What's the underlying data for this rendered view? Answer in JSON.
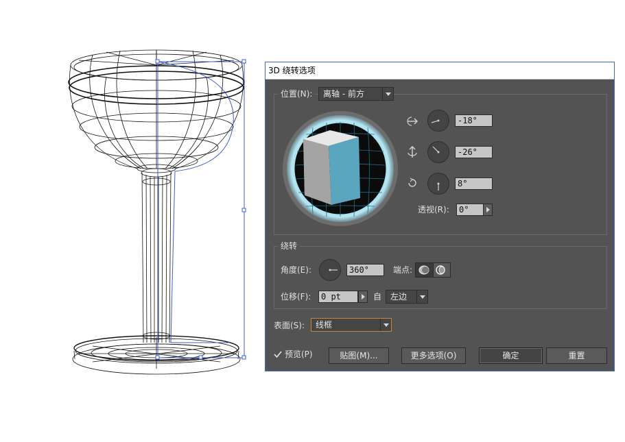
{
  "dialog": {
    "title": "3D 绕转选项",
    "position": {
      "group_label": "位置(N):",
      "preset": "离轴 - 前方",
      "x_rotation": "-18°",
      "y_rotation": "-26°",
      "z_rotation": "8°",
      "perspective_label": "透视(R):",
      "perspective_value": "0°"
    },
    "revolve": {
      "group_label": "绕转",
      "angle_label": "角度(E):",
      "angle_value": "360°",
      "cap_label": "端点:",
      "offset_label": "位移(F):",
      "offset_value": "0 pt",
      "from_label": "自",
      "from_value": "左边"
    },
    "surface": {
      "label": "表面(S):",
      "value": "线框"
    },
    "footer": {
      "preview_label": "预览(P)",
      "preview_checked": true,
      "map_art_label": "贴图(M)...",
      "more_options_label": "更多选项(O)",
      "ok_label": "确定",
      "reset_label": "重置"
    }
  },
  "colors": {
    "dialog_bg": "#535353",
    "title_bg": "#ffffff",
    "cube_front": "#5aa6bf",
    "cube_side": "#a9a9a9",
    "cube_top": "#e8e8e8",
    "ring": "#9fdfef",
    "selection": "#3b5bd6"
  }
}
